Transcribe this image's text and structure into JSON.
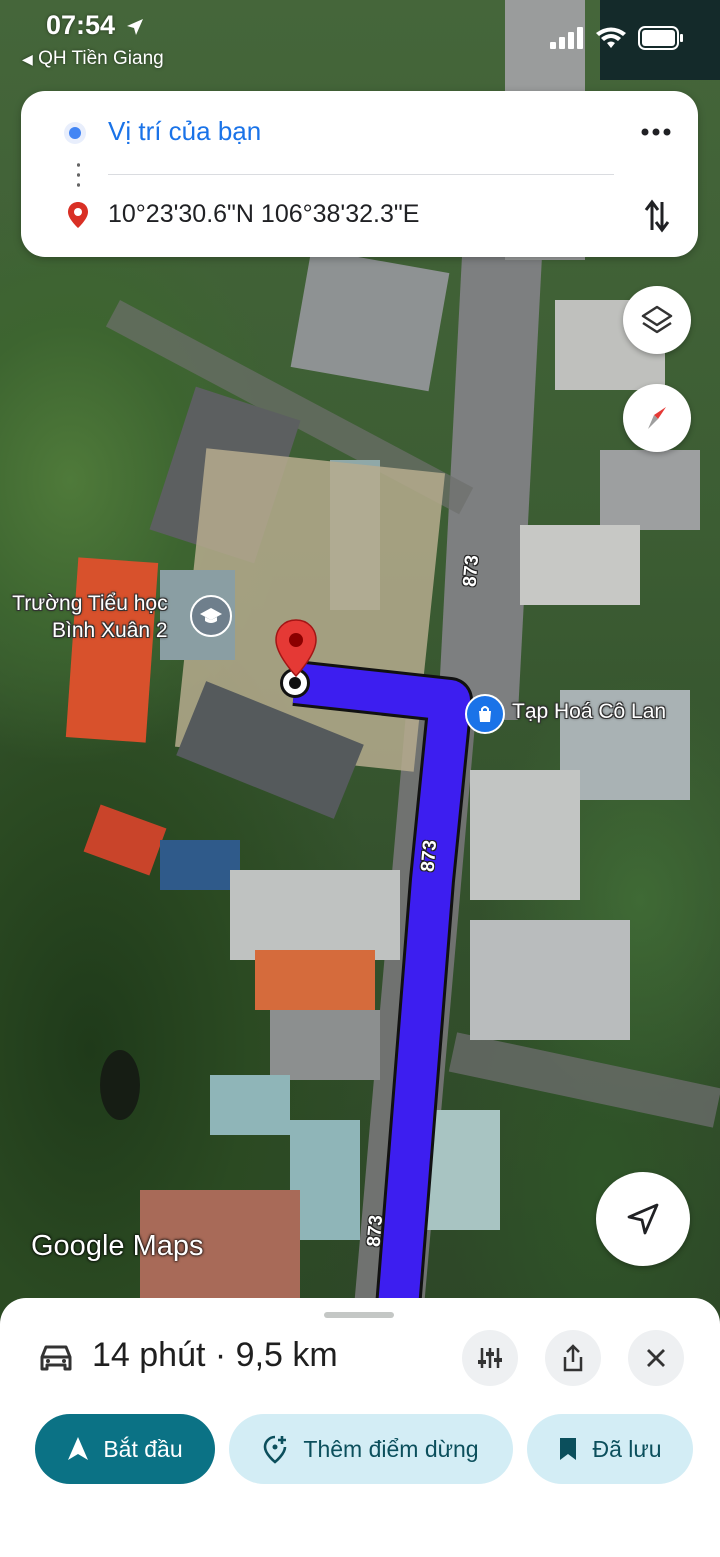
{
  "status_bar": {
    "time": "07:54",
    "back_app": "QH Tiền Giang"
  },
  "directions": {
    "origin": "Vị trí của bạn",
    "destination": "10°23'30.6\"N 106°38'32.3\"E"
  },
  "map": {
    "school_label_line1": "Trường Tiểu học",
    "school_label_line2": "Bình Xuân 2",
    "shop_label": "Tạp Hoá Cô Lan",
    "road_number": "873",
    "watermark": "Google Maps",
    "route_color": "#3d1ef0"
  },
  "route_summary": {
    "eta": "14 phút · 9,5 km"
  },
  "actions": {
    "start": "Bắt đầu",
    "add_stop": "Thêm điểm dừng",
    "saved": "Đã lưu"
  },
  "colors": {
    "accent_blue": "#1a73e8",
    "start_button": "#0b7285",
    "pill_bg": "#d3edf5",
    "pin_red": "#e53935"
  }
}
